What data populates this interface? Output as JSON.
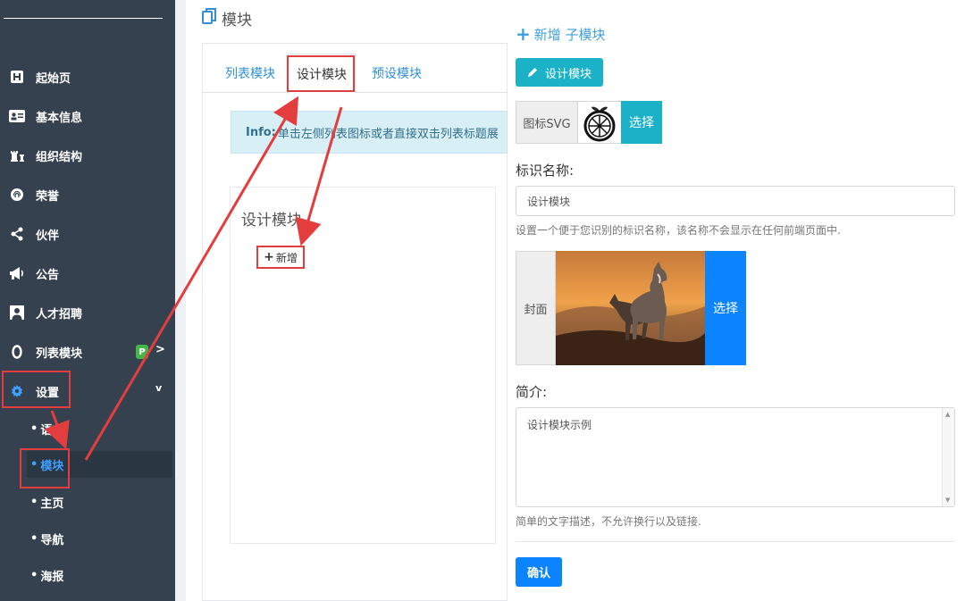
{
  "sidebar": {
    "items": [
      {
        "label": "起始页",
        "icon": "h-box-icon"
      },
      {
        "label": "基本信息",
        "icon": "id-card-icon"
      },
      {
        "label": "组织结构",
        "icon": "chess-icon"
      },
      {
        "label": "荣誉",
        "icon": "fingerprint-icon"
      },
      {
        "label": "伙伴",
        "icon": "share-icon"
      },
      {
        "label": "公告",
        "icon": "megaphone-icon"
      },
      {
        "label": "人才招聘",
        "icon": "user-icon"
      },
      {
        "label": "列表模块",
        "icon": "circle-o-icon",
        "badge": "P",
        "chevron": ">"
      },
      {
        "label": "设置",
        "icon": "gear-icon",
        "chevron": "v"
      }
    ],
    "subitems": [
      "语言",
      "模块",
      "主页",
      "导航",
      "海报"
    ],
    "active_sub": "模块"
  },
  "page": {
    "title": "模块",
    "tabs": [
      "列表模块",
      "设计模块",
      "预设模块"
    ],
    "active_tab": "设计模块",
    "info_prefix": "Info:",
    "info_text": "单击左侧列表图标或者直接双击列表标题展",
    "design_title": "设计模块",
    "add_label": "新增"
  },
  "form": {
    "sub_title": "新增 子模块",
    "design_button": "设计模块",
    "icon_label": "图标SVG",
    "icon_select": "选择",
    "name_label": "标识名称:",
    "name_value": "设计模块",
    "name_help": "设置一个便于您识别的标识名称，该名称不会显示在任何前端页面中.",
    "cover_label": "封面",
    "cover_select": "选择",
    "intro_label": "简介:",
    "intro_value": "设计模块示例",
    "intro_help": "简单的文字描述，不允许换行以及链接.",
    "confirm": "确认"
  },
  "colors": {
    "sidebar_bg": "#364150",
    "accent_teal": "#1bb2c7",
    "accent_blue": "#0d84ff",
    "highlight_red": "#e43d3d"
  }
}
